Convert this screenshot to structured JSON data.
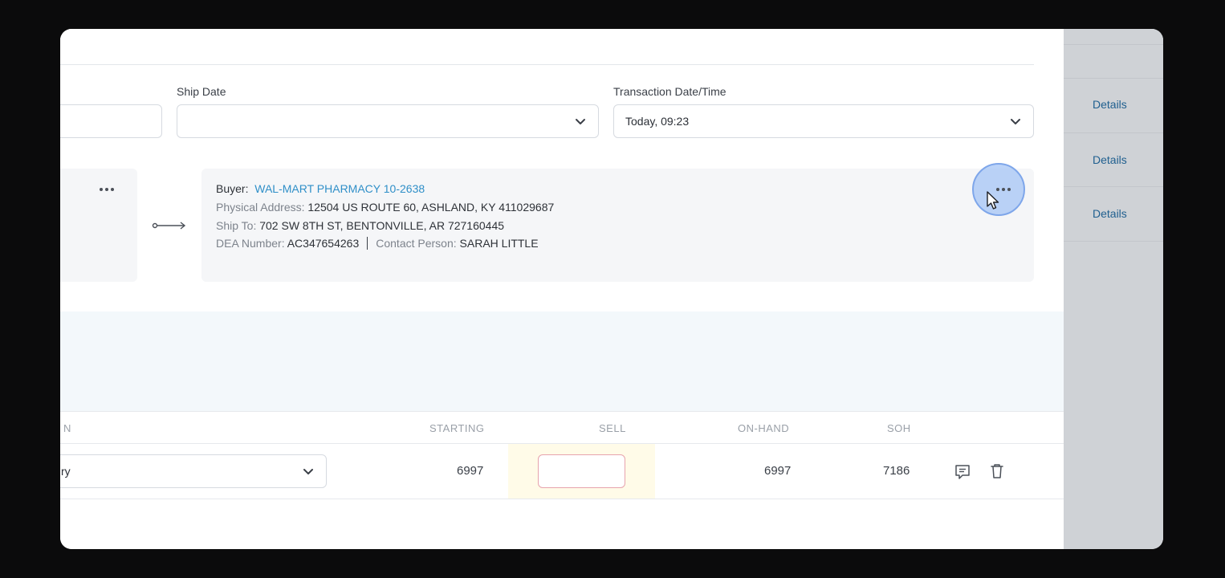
{
  "form": {
    "ship_date_label": "Ship Date",
    "ship_date_value": "",
    "transaction_label": "Transaction Date/Time",
    "transaction_value": "Today, 09:23"
  },
  "buyer": {
    "buyer_label": "Buyer:",
    "buyer_name": "WAL-MART PHARMACY 10-2638",
    "physical_label": "Physical Address:",
    "physical_value": "12504 US ROUTE 60, ASHLAND, KY 411029687",
    "shipto_label": "Ship To:",
    "shipto_value": "702 SW 8TH ST, BENTONVILLE, AR 727160445",
    "dea_label": "DEA Number:",
    "dea_value": "AC347654263",
    "contact_label": "Contact Person:",
    "contact_value": "SARAH LITTLE"
  },
  "table": {
    "headers": {
      "partial_first": "N",
      "starting": "STARTING",
      "sell": "SELL",
      "on_hand": "ON-HAND",
      "soh": "SOH"
    },
    "row": {
      "select_partial": "ry",
      "starting": "6997",
      "sell": "",
      "on_hand": "6997",
      "soh": "7186"
    }
  },
  "side": {
    "details": [
      "Details",
      "Details",
      "Details"
    ]
  },
  "icons": [
    "chevron-down-icon",
    "more-dots-icon",
    "arrow-right-icon",
    "comment-icon",
    "trash-icon",
    "cursor-icon"
  ]
}
